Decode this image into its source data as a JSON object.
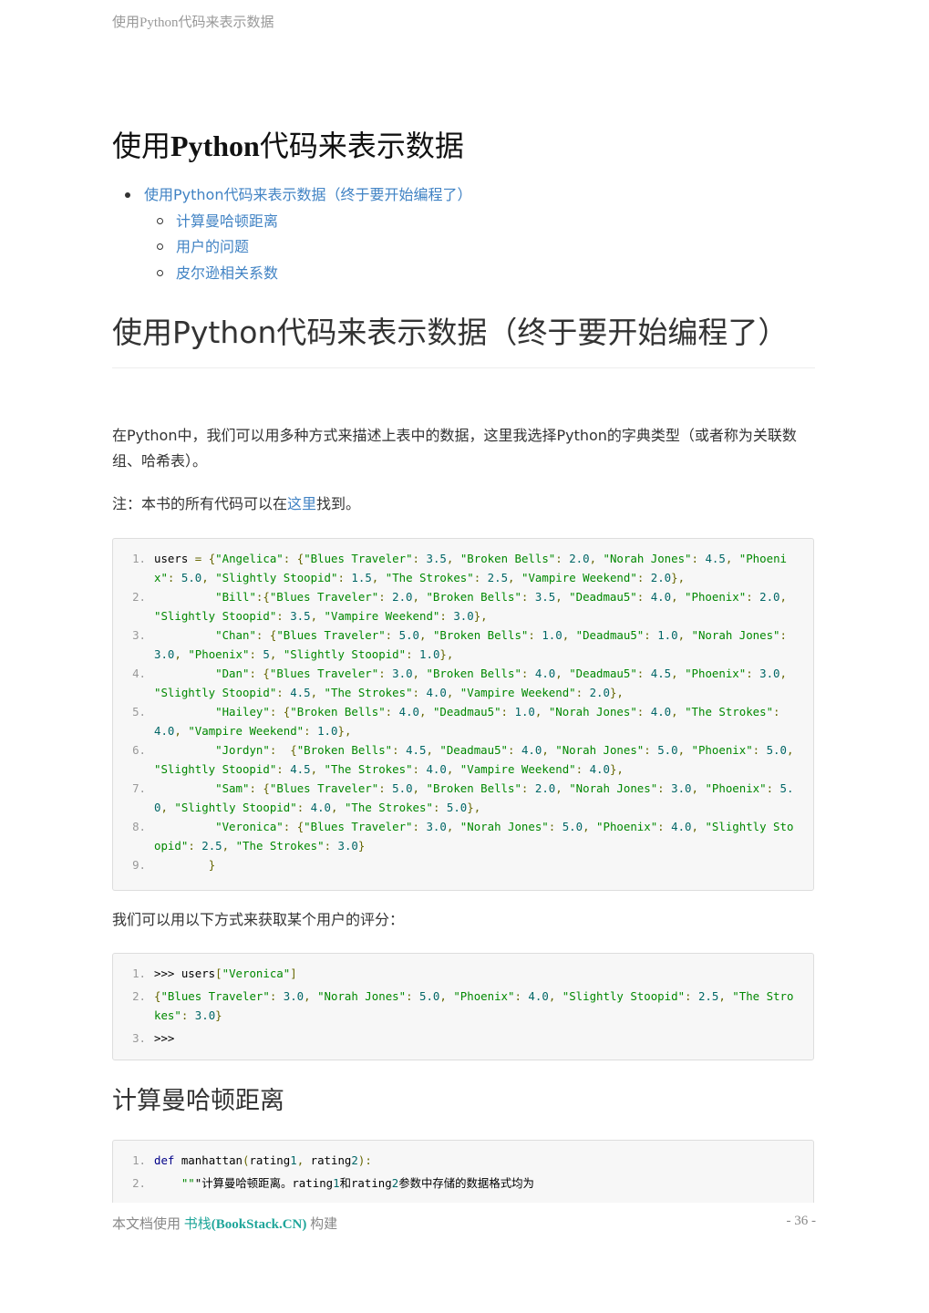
{
  "header": {
    "running_title": "使用Python代码来表示数据"
  },
  "title": {
    "part1": "使用",
    "part2": "Python",
    "part3": "代码来表示数据"
  },
  "toc": {
    "main": "使用Python代码来表示数据（终于要开始编程了）",
    "sub": [
      "计算曼哈顿距离",
      "用户的问题",
      "皮尔逊相关系数"
    ]
  },
  "section1": {
    "heading": "使用Python代码来表示数据（终于要开始编程了）",
    "para1": "在Python中，我们可以用多种方式来描述上表中的数据，这里我选择Python的字典类型（或者称为关联数组、哈希表）。",
    "note_before": "注：本书的所有代码可以在",
    "note_link": "这里",
    "note_after": "找到。",
    "para2": "我们可以用以下方式来获取某个用户的评分："
  },
  "code1": [
    {
      "n": "1.",
      "t": "users = {\"Angelica\": {\"Blues Traveler\": 3.5, \"Broken Bells\": 2.0, \"Norah Jones\": 4.5, \"Phoenix\": 5.0, \"Slightly Stoopid\": 1.5, \"The Strokes\": 2.5, \"Vampire Weekend\": 2.0},"
    },
    {
      "n": "2.",
      "t": "         \"Bill\":{\"Blues Traveler\": 2.0, \"Broken Bells\": 3.5, \"Deadmau5\": 4.0, \"Phoenix\": 2.0, \"Slightly Stoopid\": 3.5, \"Vampire Weekend\": 3.0},"
    },
    {
      "n": "3.",
      "t": "         \"Chan\": {\"Blues Traveler\": 5.0, \"Broken Bells\": 1.0, \"Deadmau5\": 1.0, \"Norah Jones\": 3.0, \"Phoenix\": 5, \"Slightly Stoopid\": 1.0},"
    },
    {
      "n": "4.",
      "t": "         \"Dan\": {\"Blues Traveler\": 3.0, \"Broken Bells\": 4.0, \"Deadmau5\": 4.5, \"Phoenix\": 3.0, \"Slightly Stoopid\": 4.5, \"The Strokes\": 4.0, \"Vampire Weekend\": 2.0},"
    },
    {
      "n": "5.",
      "t": "         \"Hailey\": {\"Broken Bells\": 4.0, \"Deadmau5\": 1.0, \"Norah Jones\": 4.0, \"The Strokes\": 4.0, \"Vampire Weekend\": 1.0},"
    },
    {
      "n": "6.",
      "t": "         \"Jordyn\":  {\"Broken Bells\": 4.5, \"Deadmau5\": 4.0, \"Norah Jones\": 5.0, \"Phoenix\": 5.0, \"Slightly Stoopid\": 4.5, \"The Strokes\": 4.0, \"Vampire Weekend\": 4.0},"
    },
    {
      "n": "7.",
      "t": "         \"Sam\": {\"Blues Traveler\": 5.0, \"Broken Bells\": 2.0, \"Norah Jones\": 3.0, \"Phoenix\": 5.0, \"Slightly Stoopid\": 4.0, \"The Strokes\": 5.0},"
    },
    {
      "n": "8.",
      "t": "         \"Veronica\": {\"Blues Traveler\": 3.0, \"Norah Jones\": 5.0, \"Phoenix\": 4.0, \"Slightly Stoopid\": 2.5, \"The Strokes\": 3.0}"
    },
    {
      "n": "9.",
      "t": "        }"
    }
  ],
  "code2": [
    {
      "n": "1.",
      "t": ">>> users[\"Veronica\"]"
    },
    {
      "n": "2.",
      "t": "{\"Blues Traveler\": 3.0, \"Norah Jones\": 5.0, \"Phoenix\": 4.0, \"Slightly Stoopid\": 2.5, \"The Strokes\": 3.0}"
    },
    {
      "n": "3.",
      "t": ">>>"
    }
  ],
  "section2": {
    "heading": "计算曼哈顿距离"
  },
  "code3": [
    {
      "n": "1.",
      "t": "def manhattan(rating1, rating2):"
    },
    {
      "n": "2.",
      "t": "    \"\"\"计算曼哈顿距离。rating1和rating2参数中存储的数据格式均为"
    }
  ],
  "footer": {
    "prefix": "本文档使用 ",
    "brand_cn": "书栈",
    "brand_en": "(BookStack.CN)",
    "suffix": " 构建",
    "page_number": "- 36 -"
  }
}
